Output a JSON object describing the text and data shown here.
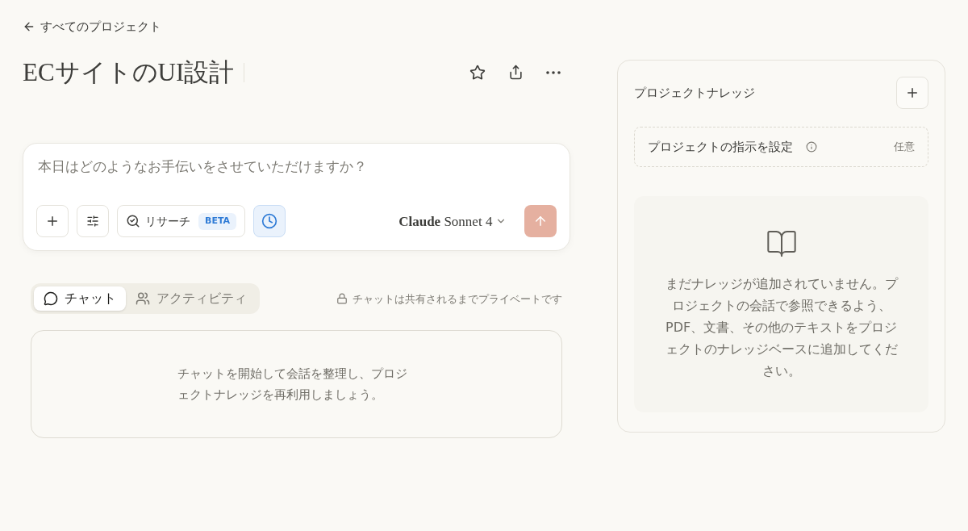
{
  "back_link": "すべてのプロジェクト",
  "project": {
    "title": "ECサイトのUI設計"
  },
  "composer": {
    "placeholder": "本日はどのようなお手伝いをさせていただけますか？",
    "research": {
      "label": "リサーチ",
      "badge": "BETA"
    },
    "extended_thinking": {
      "on": true
    },
    "model": "**Claude** Sonnet 4"
  },
  "tabs": [
    {
      "label": "チャット",
      "kind": "chat",
      "selected": true
    },
    {
      "label": "アクティビティ",
      "kind": "activity",
      "selected": false
    }
  ],
  "privacy_note": "チャットは共有されるまでプライベートです",
  "chat_empty": "チャットを開始して会話を整理し、プロジェクトナレッジを再利用しましょう。",
  "knowledge": {
    "title": "プロジェクトナレッジ",
    "instructions": {
      "label": "プロジェクトの指示を設定",
      "hint": "任意"
    },
    "empty": "まだナレッジが追加されていません。プロジェクトの会話で参照できるよう、PDF、文書、その他のテキストをプロジェクトのナレッジベースに追加してください。"
  }
}
